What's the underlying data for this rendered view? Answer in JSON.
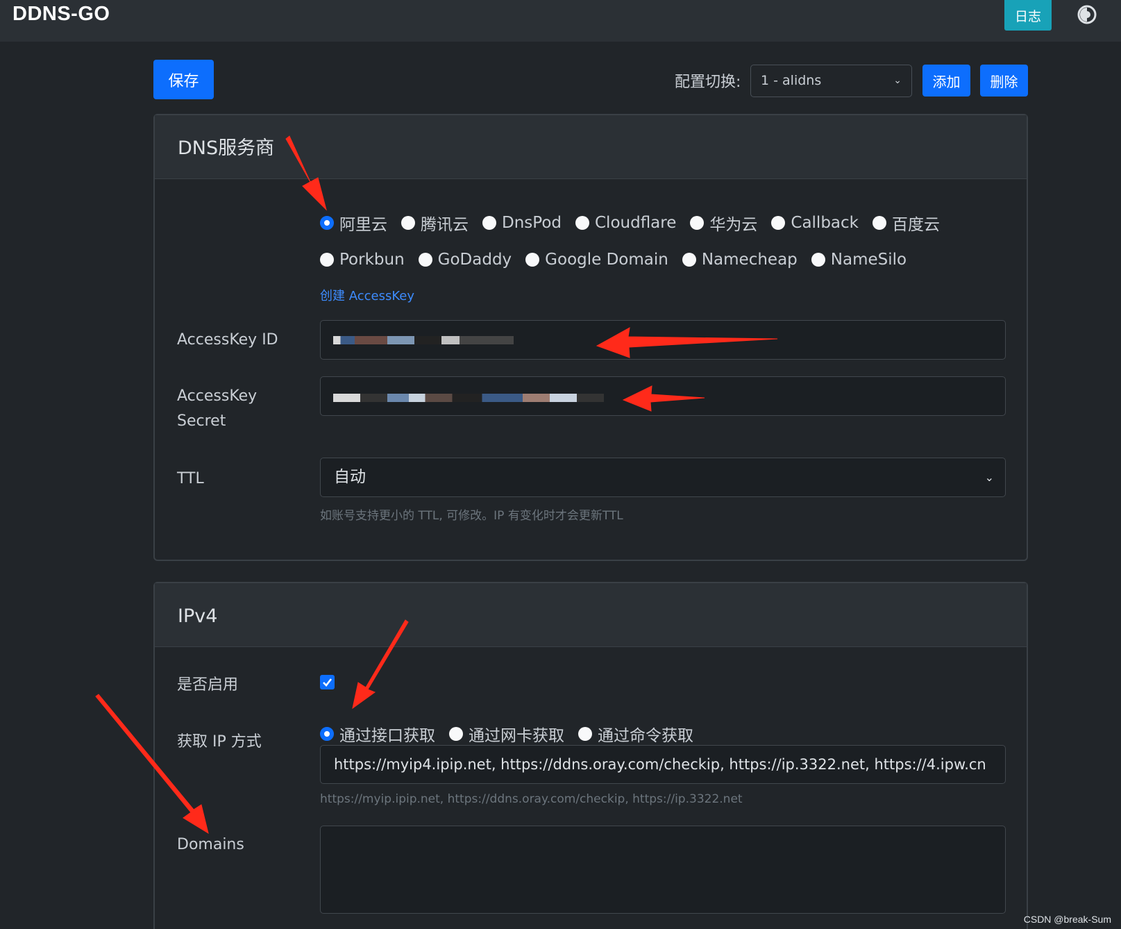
{
  "navbar": {
    "brand": "DDNS-GO",
    "log_button": "日志",
    "theme_icon": "contrast-icon"
  },
  "toolbar": {
    "save_label": "保存",
    "config_label": "配置切换:",
    "config_value": "1 - alidns",
    "add_label": "添加",
    "delete_label": "删除"
  },
  "dns_card": {
    "title": "DNS服务商",
    "providers_row1": [
      {
        "label": "阿里云",
        "selected": true
      },
      {
        "label": "腾讯云",
        "selected": false
      },
      {
        "label": "DnsPod",
        "selected": false
      },
      {
        "label": "Cloudflare",
        "selected": false
      },
      {
        "label": "华为云",
        "selected": false
      },
      {
        "label": "Callback",
        "selected": false
      },
      {
        "label": "百度云",
        "selected": false
      }
    ],
    "providers_row2": [
      {
        "label": "Porkbun",
        "selected": false
      },
      {
        "label": "GoDaddy",
        "selected": false
      },
      {
        "label": "Google Domain",
        "selected": false
      },
      {
        "label": "Namecheap",
        "selected": false
      },
      {
        "label": "NameSilo",
        "selected": false
      }
    ],
    "create_link": "创建 AccessKey",
    "access_key_id_label": "AccessKey ID",
    "access_key_secret_label_line1": "AccessKey",
    "access_key_secret_label_line2": "Secret",
    "ttl_label": "TTL",
    "ttl_value": "自动",
    "ttl_help": "如账号支持更小的 TTL, 可修改。IP 有变化时才会更新TTL"
  },
  "ipv4_card": {
    "title": "IPv4",
    "enable_label": "是否启用",
    "enabled": true,
    "method_label": "获取 IP 方式",
    "methods": [
      {
        "label": "通过接口获取",
        "selected": true
      },
      {
        "label": "通过网卡获取",
        "selected": false
      },
      {
        "label": "通过命令获取",
        "selected": false
      }
    ],
    "url_value": "https://myip4.ipip.net, https://ddns.oray.com/checkip, https://ip.3322.net, https://4.ipw.cn",
    "url_help": "https://myip.ipip.net, https://ddns.oray.com/checkip, https://ip.3322.net",
    "domains_label": "Domains",
    "domains_value": ""
  },
  "watermark": "CSDN @break-Sum",
  "colors": {
    "background": "#212529",
    "primary": "#0d6efd",
    "info": "#18a2b8",
    "annotation_arrow": "#ff2a1a"
  }
}
